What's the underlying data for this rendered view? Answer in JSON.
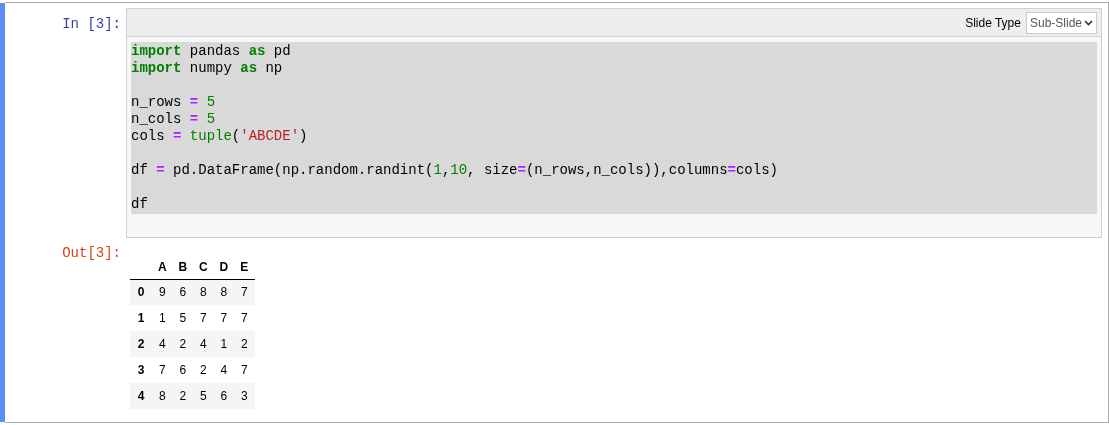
{
  "cell": {
    "input_prompt": "In [3]:",
    "slide_type": {
      "label": "Slide Type",
      "value": "Sub-Slide"
    },
    "code_lines": [
      {
        "kind": "code",
        "tokens": [
          {
            "t": "import",
            "kind": "kw"
          },
          {
            "t": " pandas ",
            "kind": "plain"
          },
          {
            "t": "as",
            "kind": "kw"
          },
          {
            "t": " pd",
            "kind": "plain"
          }
        ]
      },
      {
        "kind": "code",
        "tokens": [
          {
            "t": "import",
            "kind": "kw"
          },
          {
            "t": " numpy ",
            "kind": "plain"
          },
          {
            "t": "as",
            "kind": "kw"
          },
          {
            "t": " np",
            "kind": "plain"
          }
        ]
      },
      {
        "kind": "blank"
      },
      {
        "kind": "code",
        "tokens": [
          {
            "t": "n_rows ",
            "kind": "plain"
          },
          {
            "t": "= ",
            "kind": "op"
          },
          {
            "t": "5",
            "kind": "num"
          }
        ]
      },
      {
        "kind": "code",
        "tokens": [
          {
            "t": "n_cols ",
            "kind": "plain"
          },
          {
            "t": "= ",
            "kind": "op"
          },
          {
            "t": "5",
            "kind": "num"
          }
        ]
      },
      {
        "kind": "code",
        "tokens": [
          {
            "t": "cols ",
            "kind": "plain"
          },
          {
            "t": "= ",
            "kind": "op"
          },
          {
            "t": "tuple",
            "kind": "builtin"
          },
          {
            "t": "(",
            "kind": "plain"
          },
          {
            "t": "'ABCDE'",
            "kind": "str"
          },
          {
            "t": ")",
            "kind": "plain"
          }
        ]
      },
      {
        "kind": "blank"
      },
      {
        "kind": "code",
        "tokens": [
          {
            "t": "df ",
            "kind": "plain"
          },
          {
            "t": "=",
            "kind": "op"
          },
          {
            "t": " pd.DataFrame(np.random.randint(",
            "kind": "plain"
          },
          {
            "t": "1",
            "kind": "num"
          },
          {
            "t": ",",
            "kind": "plain"
          },
          {
            "t": "10",
            "kind": "num"
          },
          {
            "t": ", size",
            "kind": "plain"
          },
          {
            "t": "=",
            "kind": "op"
          },
          {
            "t": "(n_rows,n_cols)),columns",
            "kind": "plain"
          },
          {
            "t": "=",
            "kind": "op"
          },
          {
            "t": "cols)",
            "kind": "plain"
          }
        ]
      },
      {
        "kind": "blank"
      },
      {
        "kind": "code",
        "tokens": [
          {
            "t": "df",
            "kind": "plain"
          }
        ]
      }
    ],
    "output_prompt": "Out[3]:",
    "table": {
      "columns": [
        "A",
        "B",
        "C",
        "D",
        "E"
      ],
      "rows": [
        {
          "index": "0",
          "values": [
            "9",
            "6",
            "8",
            "8",
            "7"
          ]
        },
        {
          "index": "1",
          "values": [
            "1",
            "5",
            "7",
            "7",
            "7"
          ]
        },
        {
          "index": "2",
          "values": [
            "4",
            "2",
            "4",
            "1",
            "2"
          ]
        },
        {
          "index": "3",
          "values": [
            "7",
            "6",
            "2",
            "4",
            "7"
          ]
        },
        {
          "index": "4",
          "values": [
            "8",
            "2",
            "5",
            "6",
            "3"
          ]
        }
      ]
    }
  }
}
